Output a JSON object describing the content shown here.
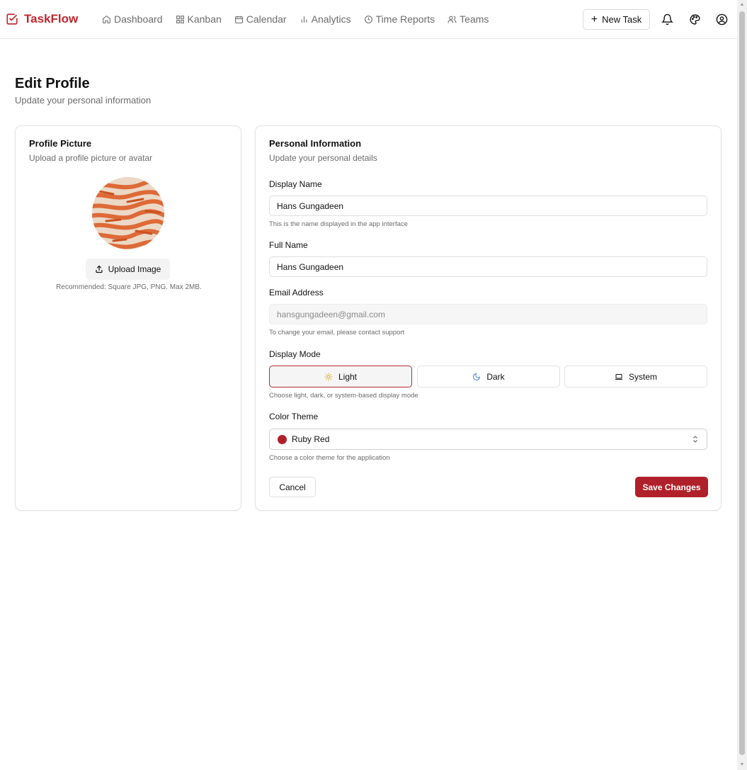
{
  "app": {
    "brand": "TaskFlow",
    "accent_color": "#b0202a"
  },
  "nav": {
    "items": [
      {
        "label": "Dashboard",
        "icon": "home-icon"
      },
      {
        "label": "Kanban",
        "icon": "grid-icon"
      },
      {
        "label": "Calendar",
        "icon": "calendar-icon"
      },
      {
        "label": "Analytics",
        "icon": "bar-chart-icon"
      },
      {
        "label": "Time Reports",
        "icon": "clock-icon"
      },
      {
        "label": "Teams",
        "icon": "users-icon"
      }
    ],
    "new_task_label": "New Task"
  },
  "page": {
    "title": "Edit Profile",
    "subtitle": "Update your personal information"
  },
  "profile_picture": {
    "title": "Profile Picture",
    "subtitle": "Upload a profile picture or avatar",
    "upload_label": "Upload Image",
    "hint": "Recommended: Square JPG, PNG. Max 2MB."
  },
  "personal_info": {
    "title": "Personal Information",
    "subtitle": "Update your personal details",
    "display_name": {
      "label": "Display Name",
      "value": "Hans Gungadeen",
      "help": "This is the name displayed in the app interface"
    },
    "full_name": {
      "label": "Full Name",
      "value": "Hans Gungadeen"
    },
    "email": {
      "label": "Email Address",
      "value": "hansgungadeen@gmail.com",
      "help": "To change your email, please contact support"
    },
    "display_mode": {
      "label": "Display Mode",
      "options": [
        "Light",
        "Dark",
        "System"
      ],
      "selected": "Light",
      "help": "Choose light, dark, or system-based display mode"
    },
    "color_theme": {
      "label": "Color Theme",
      "selected": "Ruby Red",
      "swatch_color": "#b0202a",
      "help": "Choose a color theme for the application"
    },
    "cancel_label": "Cancel",
    "save_label": "Save Changes"
  }
}
